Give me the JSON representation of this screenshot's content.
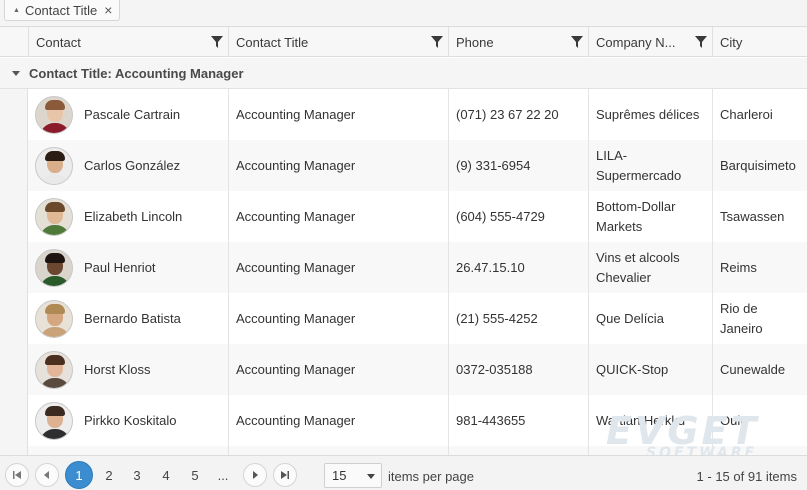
{
  "group_panel": {
    "chip_label": "Contact Title",
    "remove_glyph": "×"
  },
  "columns": [
    {
      "label": "Contact",
      "filterable": true
    },
    {
      "label": "Contact Title",
      "filterable": true
    },
    {
      "label": "Phone",
      "filterable": true
    },
    {
      "label": "Company N...",
      "filterable": true
    },
    {
      "label": "City",
      "filterable": false
    }
  ],
  "group": {
    "label": "Contact Title: Accounting Manager"
  },
  "rows": [
    {
      "contact": "Pascale Cartrain",
      "title": "Accounting Manager",
      "phone": "(071) 23 67 22 20",
      "company": "Suprêmes délices",
      "city": "Charleroi",
      "avatar": {
        "hair": "#8a5a3a",
        "skin": "#e8c4a8",
        "shirt": "#8b1a2a",
        "bg": "#ddd6cc"
      }
    },
    {
      "contact": "Carlos González",
      "title": "Accounting Manager",
      "phone": "(9) 331-6954",
      "company": "LILA-Supermercado",
      "city": "Barquisimeto",
      "avatar": {
        "hair": "#2b1d14",
        "skin": "#d9ae8a",
        "shirt": "#e9e9e9",
        "bg": "#ececec"
      }
    },
    {
      "contact": "Elizabeth Lincoln",
      "title": "Accounting Manager",
      "phone": "(604) 555-4729",
      "company": "Bottom-Dollar Markets",
      "city": "Tsawassen",
      "avatar": {
        "hair": "#6b4a2b",
        "skin": "#e0b896",
        "shirt": "#4f7a3a",
        "bg": "#e4e0d6"
      }
    },
    {
      "contact": "Paul Henriot",
      "title": "Accounting Manager",
      "phone": "26.47.15.10",
      "company": "Vins et alcools Chevalier",
      "city": "Reims",
      "avatar": {
        "hair": "#1e1410",
        "skin": "#6b4630",
        "shirt": "#2a5a2a",
        "bg": "#d9d4cc"
      }
    },
    {
      "contact": "Bernardo Batista",
      "title": "Accounting Manager",
      "phone": "(21) 555-4252",
      "company": "Que Delícia",
      "city": "Rio de Janeiro",
      "avatar": {
        "hair": "#b08a55",
        "skin": "#d6a680",
        "shirt": "#c9a27a",
        "bg": "#e8e2d6"
      }
    },
    {
      "contact": "Horst Kloss",
      "title": "Accounting Manager",
      "phone": "0372-035188",
      "company": "QUICK-Stop",
      "city": "Cunewalde",
      "avatar": {
        "hair": "#4a2f20",
        "skin": "#e2b59a",
        "shirt": "#5a4a3e",
        "bg": "#e6e1da"
      }
    },
    {
      "contact": "Pirkko Koskitalo",
      "title": "Accounting Manager",
      "phone": "981-443655",
      "company": "Wartian Herkku",
      "city": "Oulu",
      "avatar": {
        "hair": "#3a2a20",
        "skin": "#dcb292",
        "shirt": "#2e2e30",
        "bg": "#ededed"
      }
    },
    {
      "contact": "",
      "title": "",
      "phone": "",
      "company": "",
      "city": "",
      "avatar": null
    }
  ],
  "pager": {
    "pages": [
      "1",
      "2",
      "3",
      "4",
      "5",
      "..."
    ],
    "current_page": "1",
    "page_size": "15",
    "items_per_page_label": "items per page",
    "info": "1 - 15 of 91 items"
  },
  "watermark": {
    "line1": "EVGET",
    "line2": "SOFTWARE"
  },
  "colors": {
    "accent": "#3c8dcf",
    "header_bg": "#f7f7f7",
    "alt_row": "#f8f8f8"
  },
  "icons": {
    "filter": "funnel-icon",
    "first": "first-page-icon",
    "prev": "prev-page-icon",
    "next": "next-page-icon",
    "last": "last-page-icon"
  }
}
